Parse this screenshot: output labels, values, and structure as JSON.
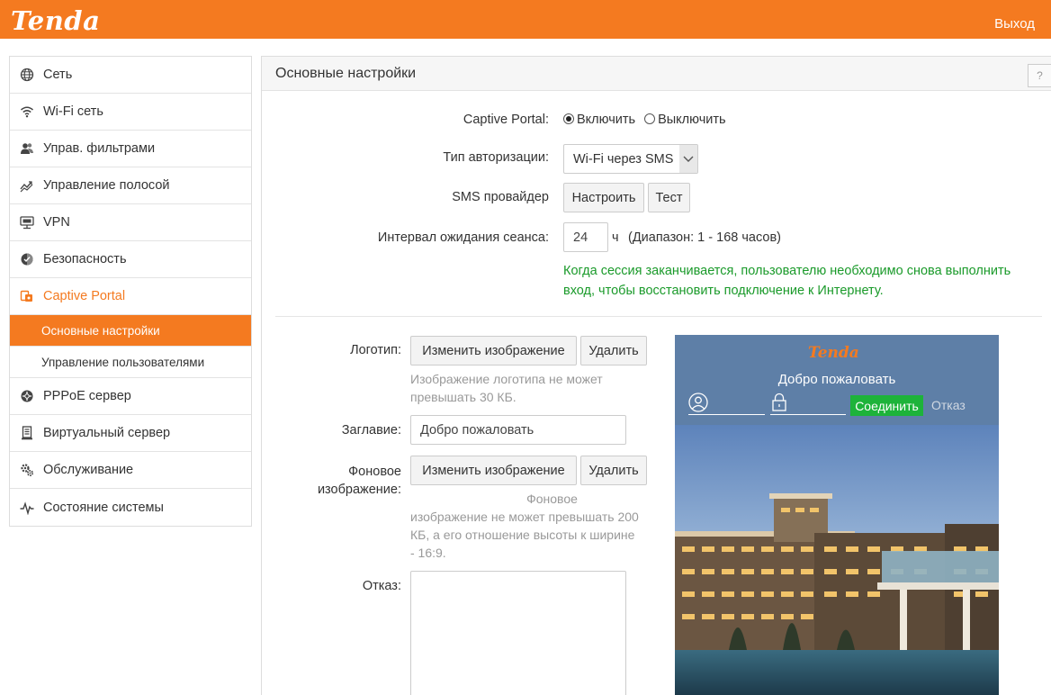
{
  "header": {
    "logo": "Tenda",
    "logout": "Выход"
  },
  "sidebar": {
    "items": [
      {
        "label": "Сеть",
        "icon": "globe-icon"
      },
      {
        "label": "Wi-Fi сеть",
        "icon": "wifi-icon"
      },
      {
        "label": "Управ. фильтрами",
        "icon": "users-icon"
      },
      {
        "label": "Управление полосой",
        "icon": "bandwidth-icon"
      },
      {
        "label": "VPN",
        "icon": "vpn-icon"
      },
      {
        "label": "Безопасность",
        "icon": "shield-icon"
      },
      {
        "label": "Captive Portal",
        "icon": "captive-portal-icon"
      },
      {
        "label": "PPPoE сервер",
        "icon": "pppoe-icon"
      },
      {
        "label": "Виртуальный сервер",
        "icon": "server-icon"
      },
      {
        "label": "Обслуживание",
        "icon": "gears-icon"
      },
      {
        "label": "Состояние системы",
        "icon": "pulse-icon"
      }
    ],
    "subitems": [
      {
        "label": "Основные настройки"
      },
      {
        "label": "Управление пользователями"
      }
    ]
  },
  "panel": {
    "title": "Основные настройки",
    "help": "?"
  },
  "form": {
    "captive_label": "Captive Portal:",
    "enable_label": "Включить",
    "disable_label": "Выключить",
    "auth_label": "Тип авторизации:",
    "auth_value": "Wi-Fi через SMS",
    "sms_label": "SMS провайдер",
    "configure_button": "Настроить",
    "test_button": "Тест",
    "timeout_label": "Интервал ожидания сеанса:",
    "timeout_value": "24",
    "timeout_unit": "ч",
    "timeout_range": "(Диапазон: 1 - 168 часов)",
    "session_note_1": "Когда сессия заканчивается, пользователю необходимо снова выполнить",
    "session_note_2": "вход, чтобы восстановить подключение к Интернету.",
    "logo_label": "Логотип:",
    "change_image_button": "Изменить изображение",
    "delete_button": "Удалить",
    "logo_hint_1": "Изображение логотипа не может",
    "logo_hint_2": "превышать 30 КБ.",
    "title_label": "Заглавие:",
    "title_value": "Добро пожаловать",
    "bg_label_1": "Фоновое",
    "bg_label_2": "изображение:",
    "bg_hint_1": "Фоновое",
    "bg_hint_2": "изображение не может превышать 200",
    "bg_hint_3": "КБ, а его отношение высоты к ширине",
    "bg_hint_4": "- 16:9.",
    "disclaimer_label": "Отказ:"
  },
  "preview": {
    "logo": "Tenda",
    "welcome": "Добро пожаловать",
    "connect": "Соединить",
    "disclaimer": "Отказ"
  },
  "colors": {
    "accent": "#f47a20",
    "note": "#1a9a2a",
    "connect": "#1db33a",
    "preview_header": "#5e7fa7"
  }
}
